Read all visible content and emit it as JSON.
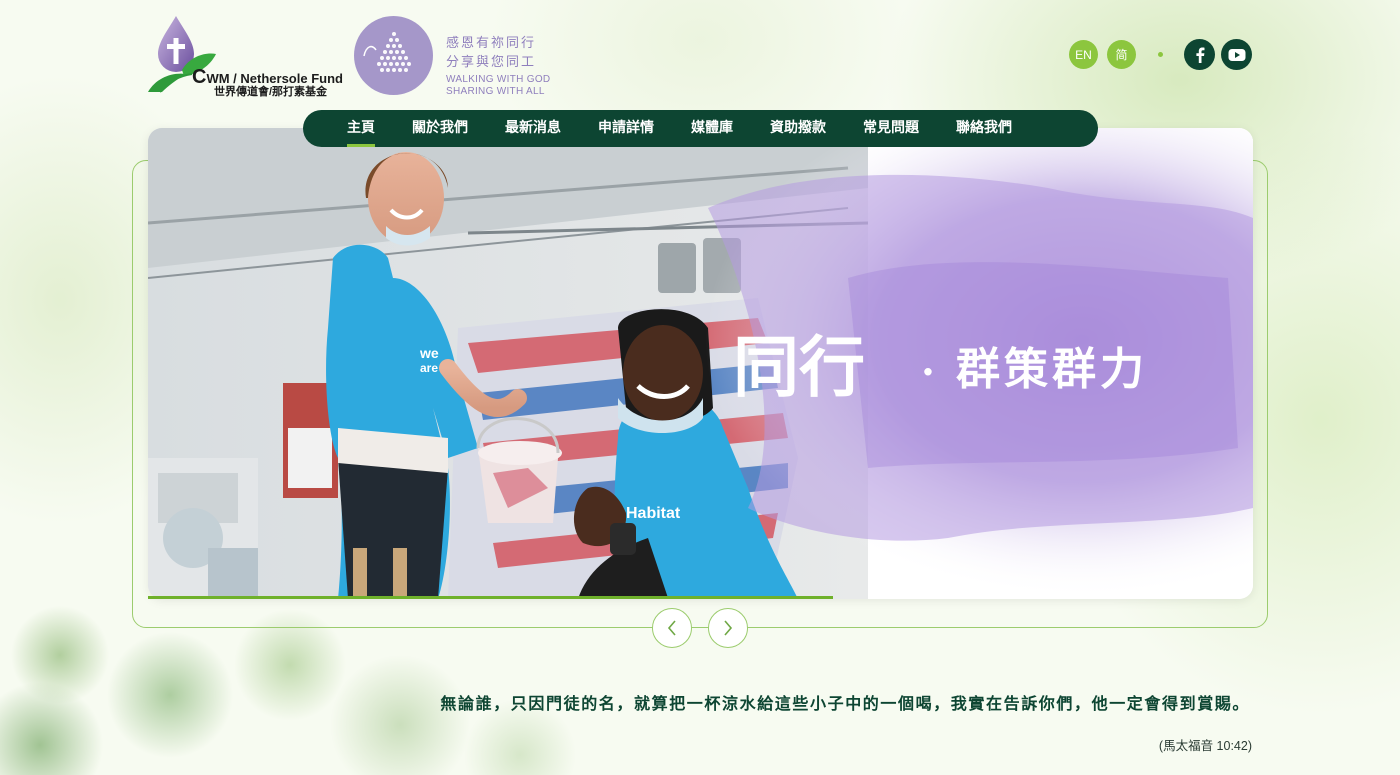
{
  "header": {
    "logo_cwm": {
      "name_en_initial": "C",
      "name_en_rest": "WM / Nethersole Fund",
      "name_zh": "世界傳道會/那打素基金"
    },
    "logo_walking": {
      "slogan_zh": "感恩有祢同行\n分享與您同工",
      "slogan_en": "WALKING  WITH GOD\nSHARING WITH ALL"
    },
    "lang_en": "EN",
    "lang_sc": "简"
  },
  "nav": {
    "items": [
      {
        "label": "主頁",
        "active": true
      },
      {
        "label": "關於我們",
        "active": false
      },
      {
        "label": "最新消息",
        "active": false
      },
      {
        "label": "申請詳情",
        "active": false
      },
      {
        "label": "媒體庫",
        "active": false
      },
      {
        "label": "資助撥款",
        "active": false
      },
      {
        "label": "常見問題",
        "active": false
      },
      {
        "label": "聯絡我們",
        "active": false
      }
    ]
  },
  "hero": {
    "headline_big": "同行",
    "headline_dot": "·",
    "headline_rest": "群策群力",
    "shirt_text_1": "we",
    "shirt_text_2": "are",
    "shirt_text_3": "Habitat",
    "progress": 0.62
  },
  "quote": {
    "text": "無論誰，只因門徒的名，就算把一杯涼水給這些小子中的一個喝，我實在告訴你們，他一定會得到賞賜。",
    "citation": "(馬太福音 10:42)"
  },
  "colors": {
    "brand_dark": "#0d4532",
    "brand_green": "#8cc63e",
    "accent_purple": "#a597c9"
  }
}
